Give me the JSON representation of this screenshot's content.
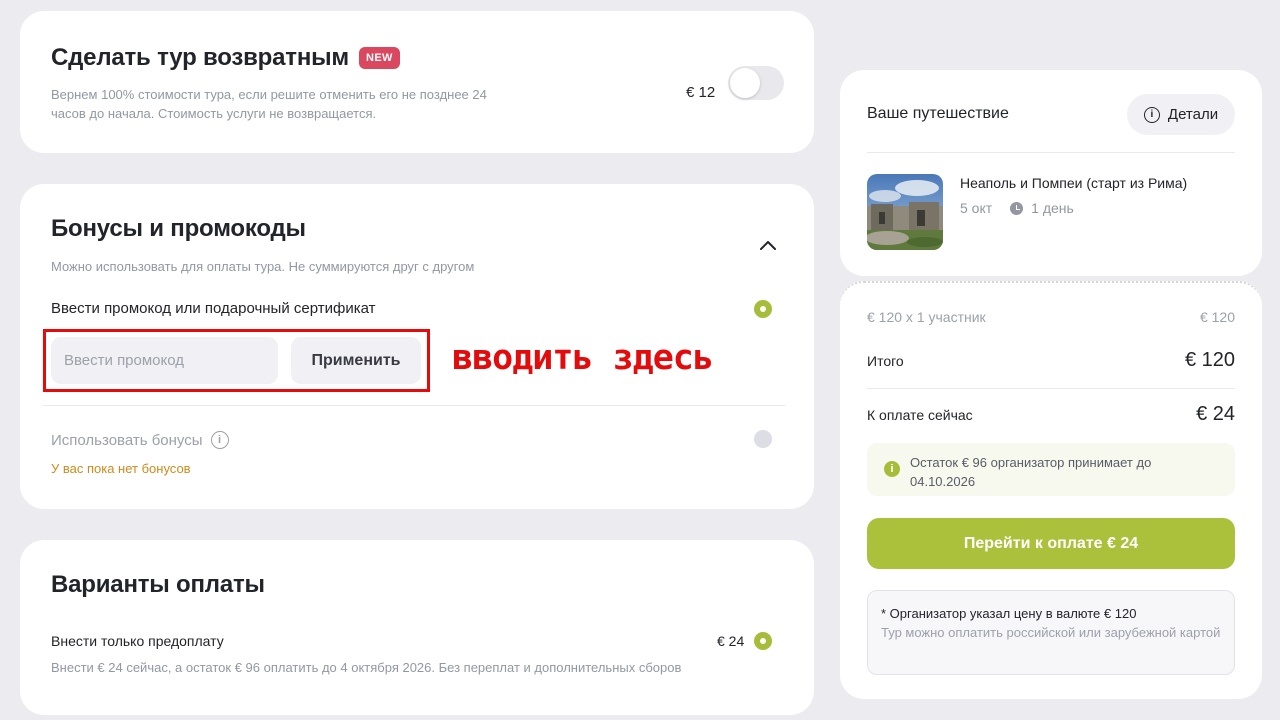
{
  "refund": {
    "title": "Сделать тур возвратным",
    "badge": "NEW",
    "description": "Вернем 100% стоимости тура, если решите отменить его не позднее 24 часов до начала. Стоимость услуги не возвращается.",
    "price": "€ 12",
    "toggle_on": false
  },
  "bonus": {
    "title": "Бонусы и промокоды",
    "subtitle": "Можно использовать для оплаты тура. Не суммируются друг с другом",
    "promo_label": "Ввести промокод или подарочный сертификат",
    "promo_placeholder": "Ввести промокод",
    "promo_value": "",
    "apply_label": "Применить",
    "annotation": "вводить здесь",
    "bonuses_label": "Использовать бонусы",
    "no_bonuses": "У вас пока нет бонусов"
  },
  "payment": {
    "title": "Варианты оплаты",
    "option_label": "Внести только предоплату",
    "option_price": "€ 24",
    "option_description": "Внести € 24 сейчас, а остаток € 96 оплатить до 4 октября 2026. Без переплат и дополнительных сборов"
  },
  "trip": {
    "heading": "Ваше путешествие",
    "details_label": "Детали",
    "tour_name": "Неаполь и Помпеи (старт из Рима)",
    "date": "5 окт",
    "duration": "1 день"
  },
  "summary": {
    "per_person_label": "€ 120 x 1 участник",
    "per_person_value": "€ 120",
    "total_label": "Итого",
    "total_value": "€ 120",
    "pay_now_label": "К оплате сейчас",
    "pay_now_value": "€ 24",
    "remainder_note": "Остаток € 96 организатор принимает до 04.10.2026",
    "pay_button": "Перейти к оплате € 24",
    "footnote_line1": "* Организатор указал цену в валюте € 120",
    "footnote_line2": "Тур можно оплатить российской или зарубежной картой"
  },
  "colors": {
    "accent_green": "#acc13b",
    "badge_red": "#d9485f",
    "annotation_red": "#e30b0b",
    "warning_orange": "#d08b1a"
  },
  "icons": [
    "chevron-up-icon",
    "info-icon",
    "clock-icon"
  ]
}
